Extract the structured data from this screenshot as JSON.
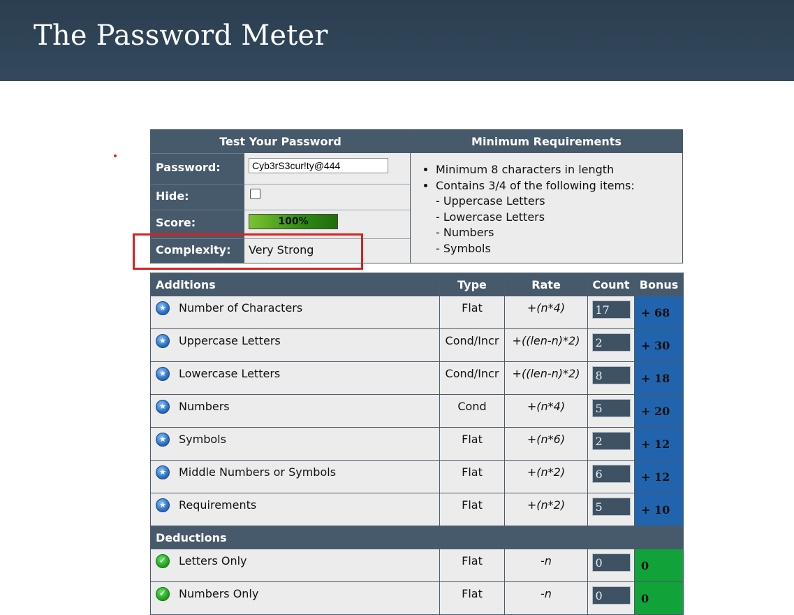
{
  "header": {
    "title": "The Password Meter"
  },
  "test": {
    "heading": "Test Your Password",
    "password_label": "Password:",
    "password_value": "Cyb3rS3cur!ty@444",
    "hide_label": "Hide:",
    "score_label": "Score:",
    "score_text": "100%",
    "score_fraction": 1.0,
    "complexity_label": "Complexity:",
    "complexity_value": "Very Strong"
  },
  "requirements": {
    "heading": "Minimum Requirements",
    "item1": "Minimum 8 characters in length",
    "item2": "Contains 3/4 of the following items:",
    "sub1": "- Uppercase Letters",
    "sub2": "- Lowercase Letters",
    "sub3": "- Numbers",
    "sub4": "- Symbols"
  },
  "table": {
    "headers": {
      "additions": "Additions",
      "type": "Type",
      "rate": "Rate",
      "count": "Count",
      "bonus": "Bonus"
    },
    "additions": [
      {
        "name": "Number of Characters",
        "type": "Flat",
        "rate": "+(n*4)",
        "count": "17",
        "bonus": "+ 68"
      },
      {
        "name": "Uppercase Letters",
        "type": "Cond/Incr",
        "rate": "+((len-n)*2)",
        "count": "2",
        "bonus": "+ 30"
      },
      {
        "name": "Lowercase Letters",
        "type": "Cond/Incr",
        "rate": "+((len-n)*2)",
        "count": "8",
        "bonus": "+ 18"
      },
      {
        "name": "Numbers",
        "type": "Cond",
        "rate": "+(n*4)",
        "count": "5",
        "bonus": "+ 20"
      },
      {
        "name": "Symbols",
        "type": "Flat",
        "rate": "+(n*6)",
        "count": "2",
        "bonus": "+ 12"
      },
      {
        "name": "Middle Numbers or Symbols",
        "type": "Flat",
        "rate": "+(n*2)",
        "count": "6",
        "bonus": "+ 12"
      },
      {
        "name": "Requirements",
        "type": "Flat",
        "rate": "+(n*2)",
        "count": "5",
        "bonus": "+ 10"
      }
    ],
    "deductions_label": "Deductions",
    "deductions": [
      {
        "name": "Letters Only",
        "type": "Flat",
        "rate": "-n",
        "count": "0",
        "bonus": "0"
      },
      {
        "name": "Numbers Only",
        "type": "Flat",
        "rate": "-n",
        "count": "0",
        "bonus": "0"
      }
    ]
  },
  "colors": {
    "header_bg": "#2b3e50",
    "bonus_blue": "#2163ad",
    "bonus_green": "#11a239",
    "highlight_red": "#d92020"
  }
}
